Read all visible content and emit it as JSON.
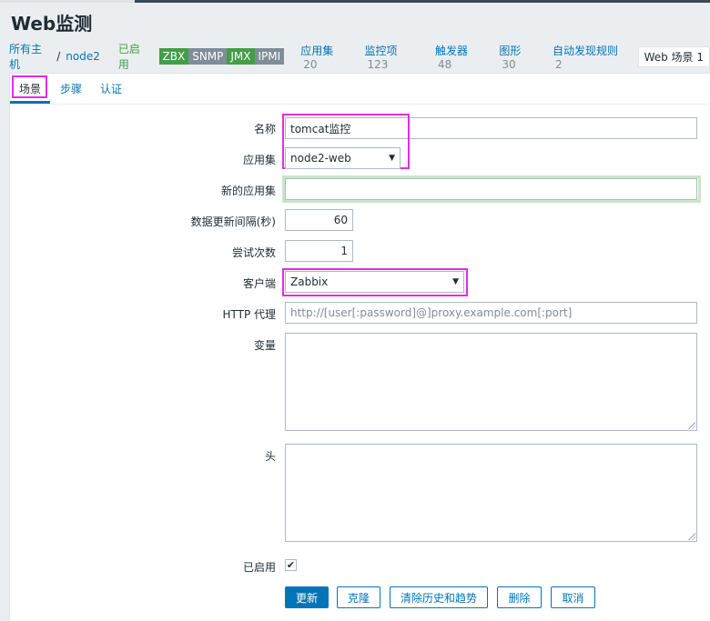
{
  "page": {
    "title": "Web监测"
  },
  "breadcrumb": {
    "all_hosts": "所有主机",
    "separator": "/",
    "host": "node2",
    "status": "已启用",
    "badges": [
      {
        "label": "ZBX",
        "color": "#429e47"
      },
      {
        "label": "SNMP",
        "color": "#7f8d96"
      },
      {
        "label": "JMX",
        "color": "#429e47"
      },
      {
        "label": "IPMI",
        "color": "#7f8d96"
      }
    ],
    "links": [
      {
        "label": "应用集",
        "count": "20"
      },
      {
        "label": "监控项",
        "count": "123"
      },
      {
        "label": "触发器",
        "count": "48"
      },
      {
        "label": "图形",
        "count": "30"
      },
      {
        "label": "自动发现规则",
        "count": "2"
      }
    ],
    "current": "Web 场景 1"
  },
  "tabs": [
    "场景",
    "步骤",
    "认证"
  ],
  "form": {
    "name_label": "名称",
    "name_value": "tomcat监控",
    "app_label": "应用集",
    "app_value": "node2-web",
    "new_app_label": "新的应用集",
    "new_app_value": "",
    "interval_label": "数据更新间隔(秒)",
    "interval_value": "60",
    "attempts_label": "尝试次数",
    "attempts_value": "1",
    "agent_label": "客户端",
    "agent_value": "Zabbix",
    "proxy_label": "HTTP 代理",
    "proxy_placeholder": "http://[user[:password]@]proxy.example.com[:port]",
    "variables_label": "变量",
    "headers_label": "头",
    "enabled_label": "已启用",
    "enabled_mark": "✔"
  },
  "buttons": {
    "update": "更新",
    "clone": "克隆",
    "clear_history": "清除历史和趋势",
    "delete": "删除",
    "cancel": "取消"
  },
  "colors": {
    "accent": "#0275b8",
    "highlight": "#e02ee0",
    "enabled": "#429e47"
  }
}
